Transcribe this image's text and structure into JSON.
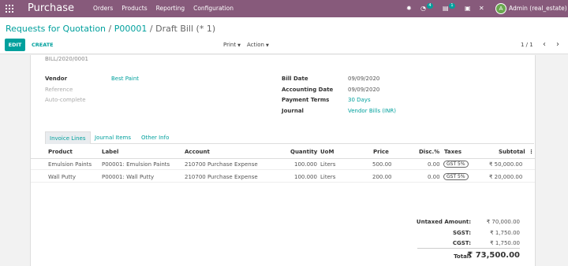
{
  "navbar": {
    "app_title": "Purchase",
    "menu": [
      "Orders",
      "Products",
      "Reporting",
      "Configuration"
    ],
    "activity_badge": "4",
    "messages_badge": "1",
    "avatar_letter": "A",
    "user": "Admin (real_estate)",
    "color": "#875A7B"
  },
  "breadcrumb": {
    "root": "Requests for Quotation",
    "sep1": "/",
    "parent": "P00001",
    "sep2": "/",
    "current": "Draft Bill (* 1)"
  },
  "actions": {
    "edit": "EDIT",
    "create": "CREATE",
    "print": "Print",
    "action": "Action",
    "pager": "1 / 1"
  },
  "bill": {
    "number": "BILL/2020/0001",
    "vendor_label": "Vendor",
    "vendor": "Best Paint",
    "reference_label": "Reference",
    "autocomplete_label": "Auto-complete",
    "bill_date_label": "Bill Date",
    "bill_date": "09/09/2020",
    "accounting_date_label": "Accounting Date",
    "accounting_date": "09/09/2020",
    "payment_terms_label": "Payment Terms",
    "payment_terms": "30 Days",
    "journal_label": "Journal",
    "journal": "Vendor Bills (INR)"
  },
  "tabs": [
    "Invoice Lines",
    "Journal Items",
    "Other Info"
  ],
  "table": {
    "headers": [
      "Product",
      "Label",
      "Account",
      "Quantity",
      "UoM",
      "Price",
      "Disc.%",
      "Taxes",
      "Subtotal"
    ],
    "rows": [
      [
        "Emulsion Paints",
        "P00001: Emulsion Paints",
        "210700 Purchase Expense",
        "100.000",
        "Liters",
        "500.00",
        "0.00",
        "GST 5%",
        "₹ 50,000.00"
      ],
      [
        "Wall Putty",
        "P00001: Wall Putty",
        "210700 Purchase Expense",
        "100.000",
        "Liters",
        "200.00",
        "0.00",
        "GST 5%",
        "₹ 20,000.00"
      ]
    ]
  },
  "totals": {
    "untaxed_label": "Untaxed Amount:",
    "untaxed": "₹ 70,000.00",
    "sgst_label": "SGST:",
    "sgst": "₹ 1,750.00",
    "cgst_label": "CGST:",
    "cgst": "₹ 1,750.00",
    "total_label": "Total:",
    "total": "₹ 73,500.00"
  }
}
